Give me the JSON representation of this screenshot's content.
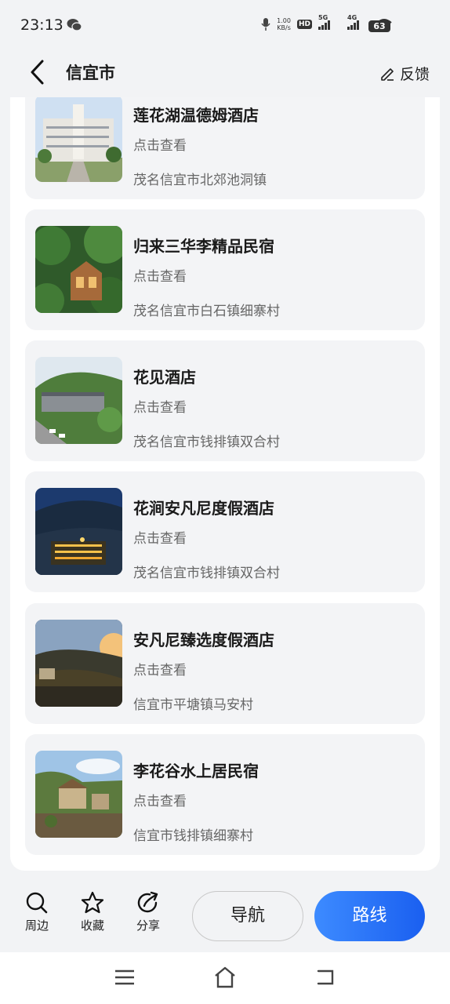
{
  "status_bar": {
    "time": "23:13",
    "net_speed_value": "1.00",
    "net_speed_unit": "KB/s",
    "hd": "HD",
    "net1": "5G",
    "net2": "4G",
    "battery": "63"
  },
  "header": {
    "title": "信宜市",
    "feedback_label": "反馈"
  },
  "hotels": [
    {
      "name": "莲花湖温德姆酒店",
      "action": "点击查看",
      "address": "茂名信宜市北郊池洞镇"
    },
    {
      "name": "归来三华李精品民宿",
      "action": "点击查看",
      "address": "茂名信宜市白石镇细寨村"
    },
    {
      "name": "花见酒店",
      "action": "点击查看",
      "address": "茂名信宜市钱排镇双合村"
    },
    {
      "name": "花涧安凡尼度假酒店",
      "action": "点击查看",
      "address": "茂名信宜市钱排镇双合村"
    },
    {
      "name": "安凡尼臻选度假酒店",
      "action": "点击查看",
      "address": "信宜市平塘镇马安村"
    },
    {
      "name": "李花谷水上居民宿",
      "action": "点击查看",
      "address": "信宜市钱排镇细寨村"
    }
  ],
  "bottom_bar": {
    "nearby_label": "周边",
    "favorite_label": "收藏",
    "share_label": "分享",
    "navigate_label": "导航",
    "route_label": "路线"
  },
  "colors": {
    "route_button": "#1a5ff0",
    "card_background": "#f3f4f6",
    "page_background": "#f2f3f5"
  }
}
